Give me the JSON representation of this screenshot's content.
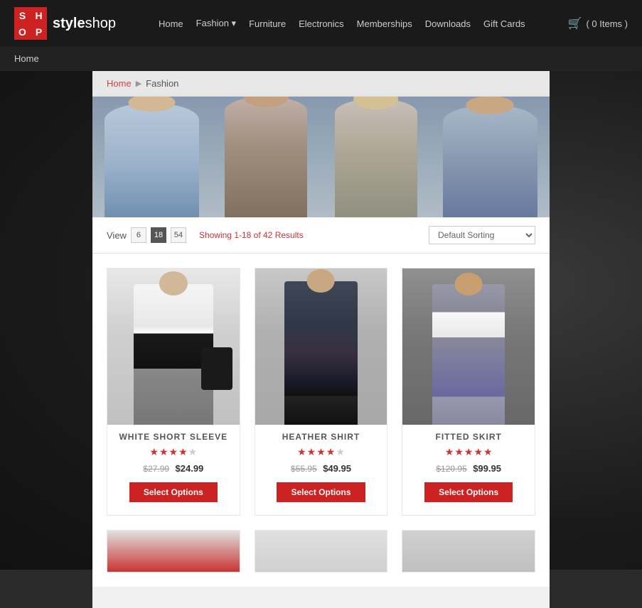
{
  "header": {
    "logo_letters": [
      "S",
      "H",
      "O",
      "P"
    ],
    "logo_name_bold": "style",
    "logo_name_light": "shop",
    "nav_items": [
      {
        "label": "Home",
        "href": "#",
        "has_arrow": false
      },
      {
        "label": "Fashion",
        "href": "#",
        "has_arrow": true
      },
      {
        "label": "Furniture",
        "href": "#",
        "has_arrow": false
      },
      {
        "label": "Electronics",
        "href": "#",
        "has_arrow": false
      },
      {
        "label": "Memberships",
        "href": "#",
        "has_arrow": false
      },
      {
        "label": "Downloads",
        "href": "#",
        "has_arrow": false
      },
      {
        "label": "Gift Cards",
        "href": "#",
        "has_arrow": false
      }
    ],
    "cart_label": "( 0 Items )"
  },
  "page_title_bar": {
    "label": "Home"
  },
  "breadcrumb": {
    "home": "Home",
    "current": "Fashion"
  },
  "toolbar": {
    "view_label": "View",
    "view_options": [
      "6",
      "18",
      "54"
    ],
    "active_view": "18",
    "results_text": "Showing 1-18 of 42 Results",
    "sort_default": "Default Sorting"
  },
  "products": [
    {
      "name": "WHITE SHORT SLEEVE",
      "rating": 4,
      "max_rating": 5,
      "price_original": "$27.99",
      "price_sale": "$24.99",
      "btn_label": "Select Options",
      "img_style": "1"
    },
    {
      "name": "HEATHER SHIRT",
      "rating": 4,
      "max_rating": 5,
      "price_original": "$55.95",
      "price_sale": "$49.95",
      "btn_label": "Select Options",
      "img_style": "2"
    },
    {
      "name": "FITTED SKIRT",
      "rating": 5,
      "max_rating": 5,
      "price_original": "$120.95",
      "price_sale": "$99.95",
      "btn_label": "Select Options",
      "img_style": "3"
    }
  ],
  "colors": {
    "accent_red": "#cc2222",
    "nav_bg": "#1a1a1a",
    "content_bg": "#f0f0f0"
  }
}
